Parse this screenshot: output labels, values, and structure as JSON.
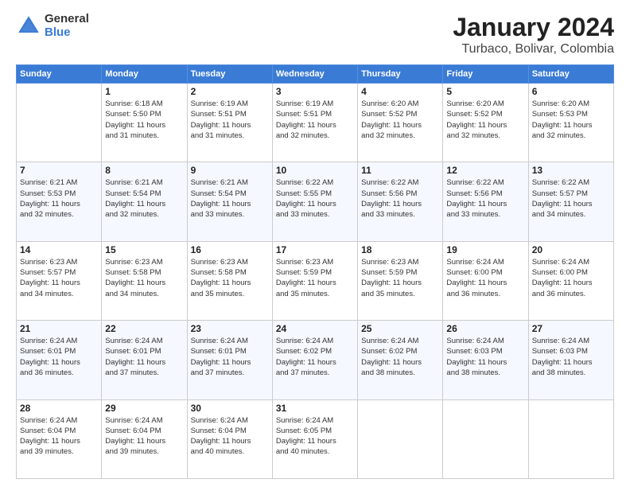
{
  "logo": {
    "general": "General",
    "blue": "Blue"
  },
  "title": "January 2024",
  "subtitle": "Turbaco, Bolivar, Colombia",
  "headers": [
    "Sunday",
    "Monday",
    "Tuesday",
    "Wednesday",
    "Thursday",
    "Friday",
    "Saturday"
  ],
  "weeks": [
    [
      {
        "day": "",
        "info": ""
      },
      {
        "day": "1",
        "info": "Sunrise: 6:18 AM\nSunset: 5:50 PM\nDaylight: 11 hours\nand 31 minutes."
      },
      {
        "day": "2",
        "info": "Sunrise: 6:19 AM\nSunset: 5:51 PM\nDaylight: 11 hours\nand 31 minutes."
      },
      {
        "day": "3",
        "info": "Sunrise: 6:19 AM\nSunset: 5:51 PM\nDaylight: 11 hours\nand 32 minutes."
      },
      {
        "day": "4",
        "info": "Sunrise: 6:20 AM\nSunset: 5:52 PM\nDaylight: 11 hours\nand 32 minutes."
      },
      {
        "day": "5",
        "info": "Sunrise: 6:20 AM\nSunset: 5:52 PM\nDaylight: 11 hours\nand 32 minutes."
      },
      {
        "day": "6",
        "info": "Sunrise: 6:20 AM\nSunset: 5:53 PM\nDaylight: 11 hours\nand 32 minutes."
      }
    ],
    [
      {
        "day": "7",
        "info": "Sunrise: 6:21 AM\nSunset: 5:53 PM\nDaylight: 11 hours\nand 32 minutes."
      },
      {
        "day": "8",
        "info": "Sunrise: 6:21 AM\nSunset: 5:54 PM\nDaylight: 11 hours\nand 32 minutes."
      },
      {
        "day": "9",
        "info": "Sunrise: 6:21 AM\nSunset: 5:54 PM\nDaylight: 11 hours\nand 33 minutes."
      },
      {
        "day": "10",
        "info": "Sunrise: 6:22 AM\nSunset: 5:55 PM\nDaylight: 11 hours\nand 33 minutes."
      },
      {
        "day": "11",
        "info": "Sunrise: 6:22 AM\nSunset: 5:56 PM\nDaylight: 11 hours\nand 33 minutes."
      },
      {
        "day": "12",
        "info": "Sunrise: 6:22 AM\nSunset: 5:56 PM\nDaylight: 11 hours\nand 33 minutes."
      },
      {
        "day": "13",
        "info": "Sunrise: 6:22 AM\nSunset: 5:57 PM\nDaylight: 11 hours\nand 34 minutes."
      }
    ],
    [
      {
        "day": "14",
        "info": "Sunrise: 6:23 AM\nSunset: 5:57 PM\nDaylight: 11 hours\nand 34 minutes."
      },
      {
        "day": "15",
        "info": "Sunrise: 6:23 AM\nSunset: 5:58 PM\nDaylight: 11 hours\nand 34 minutes."
      },
      {
        "day": "16",
        "info": "Sunrise: 6:23 AM\nSunset: 5:58 PM\nDaylight: 11 hours\nand 35 minutes."
      },
      {
        "day": "17",
        "info": "Sunrise: 6:23 AM\nSunset: 5:59 PM\nDaylight: 11 hours\nand 35 minutes."
      },
      {
        "day": "18",
        "info": "Sunrise: 6:23 AM\nSunset: 5:59 PM\nDaylight: 11 hours\nand 35 minutes."
      },
      {
        "day": "19",
        "info": "Sunrise: 6:24 AM\nSunset: 6:00 PM\nDaylight: 11 hours\nand 36 minutes."
      },
      {
        "day": "20",
        "info": "Sunrise: 6:24 AM\nSunset: 6:00 PM\nDaylight: 11 hours\nand 36 minutes."
      }
    ],
    [
      {
        "day": "21",
        "info": "Sunrise: 6:24 AM\nSunset: 6:01 PM\nDaylight: 11 hours\nand 36 minutes."
      },
      {
        "day": "22",
        "info": "Sunrise: 6:24 AM\nSunset: 6:01 PM\nDaylight: 11 hours\nand 37 minutes."
      },
      {
        "day": "23",
        "info": "Sunrise: 6:24 AM\nSunset: 6:01 PM\nDaylight: 11 hours\nand 37 minutes."
      },
      {
        "day": "24",
        "info": "Sunrise: 6:24 AM\nSunset: 6:02 PM\nDaylight: 11 hours\nand 37 minutes."
      },
      {
        "day": "25",
        "info": "Sunrise: 6:24 AM\nSunset: 6:02 PM\nDaylight: 11 hours\nand 38 minutes."
      },
      {
        "day": "26",
        "info": "Sunrise: 6:24 AM\nSunset: 6:03 PM\nDaylight: 11 hours\nand 38 minutes."
      },
      {
        "day": "27",
        "info": "Sunrise: 6:24 AM\nSunset: 6:03 PM\nDaylight: 11 hours\nand 38 minutes."
      }
    ],
    [
      {
        "day": "28",
        "info": "Sunrise: 6:24 AM\nSunset: 6:04 PM\nDaylight: 11 hours\nand 39 minutes."
      },
      {
        "day": "29",
        "info": "Sunrise: 6:24 AM\nSunset: 6:04 PM\nDaylight: 11 hours\nand 39 minutes."
      },
      {
        "day": "30",
        "info": "Sunrise: 6:24 AM\nSunset: 6:04 PM\nDaylight: 11 hours\nand 40 minutes."
      },
      {
        "day": "31",
        "info": "Sunrise: 6:24 AM\nSunset: 6:05 PM\nDaylight: 11 hours\nand 40 minutes."
      },
      {
        "day": "",
        "info": ""
      },
      {
        "day": "",
        "info": ""
      },
      {
        "day": "",
        "info": ""
      }
    ]
  ]
}
